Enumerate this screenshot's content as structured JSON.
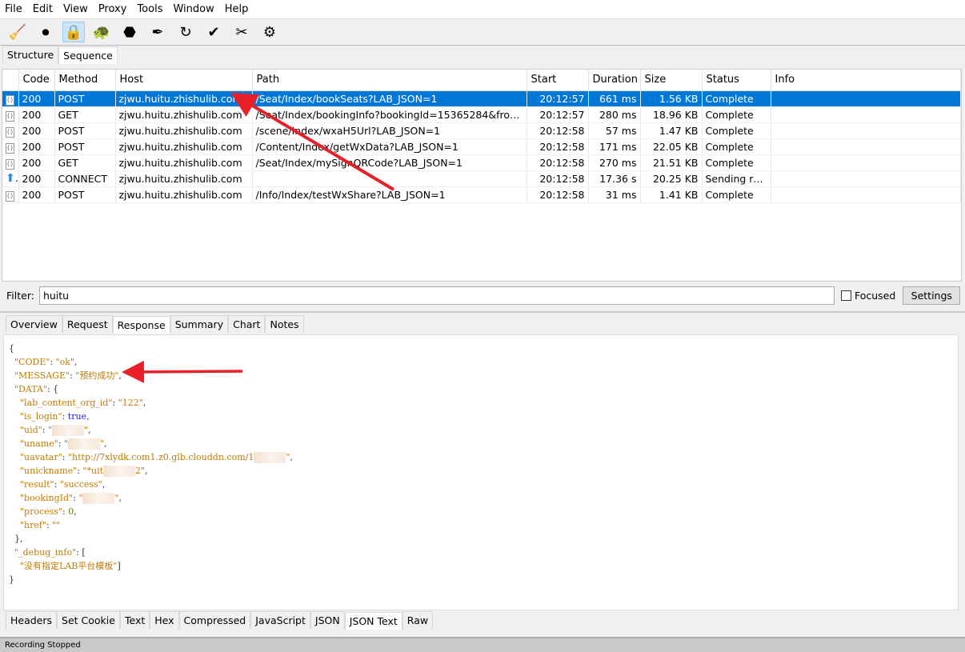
{
  "menu": [
    "File",
    "Edit",
    "View",
    "Proxy",
    "Tools",
    "Window",
    "Help"
  ],
  "toolbar": [
    {
      "icon": "broom-icon",
      "g": "🧹"
    },
    {
      "icon": "record-icon",
      "g": "⏺"
    },
    {
      "icon": "ssl-lock-icon",
      "g": "🔒",
      "active": true
    },
    {
      "icon": "throttle-turtle-icon",
      "g": "🐢"
    },
    {
      "icon": "stop-hexagon-icon",
      "g": "⬣"
    },
    {
      "icon": "compose-pen-icon",
      "g": "✒"
    },
    {
      "icon": "repeat-icon",
      "g": "↻"
    },
    {
      "icon": "validate-check-icon",
      "g": "✔"
    },
    {
      "icon": "tools-icon",
      "g": "✂"
    },
    {
      "icon": "settings-gear-icon",
      "g": "⚙"
    }
  ],
  "view_tabs": [
    "Structure",
    "Sequence"
  ],
  "table": {
    "columns": [
      "",
      "Code",
      "Method",
      "Host",
      "Path",
      "Start",
      "Duration",
      "Size",
      "Status",
      "Info"
    ],
    "rows": [
      [
        "json",
        "200",
        "POST",
        "zjwu.huitu.zhishulib.com",
        "/Seat/Index/bookSeats?LAB_JSON=1",
        "20:12:57",
        "661 ms",
        "1.56 KB",
        "Complete",
        ""
      ],
      [
        "json",
        "200",
        "GET",
        "zjwu.huitu.zhishulib.com",
        "/Seat/Index/bookingInfo?bookingId=15365284&fromTy...",
        "20:12:57",
        "280 ms",
        "18.96 KB",
        "Complete",
        ""
      ],
      [
        "json",
        "200",
        "POST",
        "zjwu.huitu.zhishulib.com",
        "/scene/Index/wxaH5Url?LAB_JSON=1",
        "20:12:58",
        "57 ms",
        "1.47 KB",
        "Complete",
        ""
      ],
      [
        "json",
        "200",
        "POST",
        "zjwu.huitu.zhishulib.com",
        "/Content/Index/getWxData?LAB_JSON=1",
        "20:12:58",
        "171 ms",
        "22.05 KB",
        "Complete",
        ""
      ],
      [
        "json",
        "200",
        "GET",
        "zjwu.huitu.zhishulib.com",
        "/Seat/Index/mySignQRCode?LAB_JSON=1",
        "20:12:58",
        "270 ms",
        "21.51 KB",
        "Complete",
        ""
      ],
      [
        "upload",
        "200",
        "CONNECT",
        "zjwu.huitu.zhishulib.com",
        "",
        "20:12:58",
        "17.36 s",
        "20.25 KB",
        "Sending re...",
        ""
      ],
      [
        "json",
        "200",
        "POST",
        "zjwu.huitu.zhishulib.com",
        "/Info/Index/testWxShare?LAB_JSON=1",
        "20:12:58",
        "31 ms",
        "1.41 KB",
        "Complete",
        ""
      ]
    ]
  },
  "filter": {
    "label": "Filter:",
    "value": "huitu",
    "focused_label": "Focused",
    "settings_label": "Settings"
  },
  "detail_tabs": [
    "Overview",
    "Request",
    "Response",
    "Summary",
    "Chart",
    "Notes"
  ],
  "detail_selected": "Response",
  "body_tabs": [
    "Headers",
    "Set Cookie",
    "Text",
    "Hex",
    "Compressed",
    "JavaScript",
    "JSON",
    "JSON Text",
    "Raw"
  ],
  "body_selected": "JSON Text",
  "json_lines": [
    [
      [
        "p",
        "{"
      ]
    ],
    [
      [
        "p",
        "  "
      ],
      [
        "k",
        "\"CODE\""
      ],
      [
        "p",
        ": "
      ],
      [
        "s",
        "\"ok\""
      ],
      [
        "p",
        ","
      ]
    ],
    [
      [
        "p",
        "  "
      ],
      [
        "k",
        "\"MESSAGE\""
      ],
      [
        "p",
        ": "
      ],
      [
        "s",
        "\"预约成功\""
      ],
      [
        "p",
        ","
      ]
    ],
    [
      [
        "p",
        "  "
      ],
      [
        "k",
        "\"DATA\""
      ],
      [
        "p",
        ": {"
      ]
    ],
    [
      [
        "p",
        "    "
      ],
      [
        "k",
        "\"lab_content_org_id\""
      ],
      [
        "p",
        ": "
      ],
      [
        "s",
        "\"122\""
      ],
      [
        "p",
        ","
      ]
    ],
    [
      [
        "p",
        "    "
      ],
      [
        "k",
        "\"is_login\""
      ],
      [
        "p",
        ": "
      ],
      [
        "b",
        "true"
      ],
      [
        "p",
        ","
      ]
    ],
    [
      [
        "p",
        "    "
      ],
      [
        "k",
        "\"uid\""
      ],
      [
        "p",
        ": "
      ],
      [
        "s",
        "\""
      ],
      [
        "r",
        ""
      ],
      [
        "s",
        "\""
      ],
      [
        "p",
        ","
      ]
    ],
    [
      [
        "p",
        "    "
      ],
      [
        "k",
        "\"uname\""
      ],
      [
        "p",
        ": "
      ],
      [
        "s",
        "\""
      ],
      [
        "r",
        ""
      ],
      [
        "s",
        "\""
      ],
      [
        "p",
        ","
      ]
    ],
    [
      [
        "p",
        "    "
      ],
      [
        "k",
        "\"uavatar\""
      ],
      [
        "p",
        ": "
      ],
      [
        "s",
        "\"http://7xlydk.com1.z0.glb.clouddn.com/1"
      ],
      [
        "r",
        ""
      ],
      [
        "s",
        "\""
      ],
      [
        "p",
        ","
      ]
    ],
    [
      [
        "p",
        "    "
      ],
      [
        "k",
        "\"unickname\""
      ],
      [
        "p",
        ": "
      ],
      [
        "s",
        "\"*uit"
      ],
      [
        "r",
        ""
      ],
      [
        "s",
        "2\""
      ],
      [
        "p",
        ","
      ]
    ],
    [
      [
        "p",
        "    "
      ],
      [
        "k",
        "\"result\""
      ],
      [
        "p",
        ": "
      ],
      [
        "s",
        "\"success\""
      ],
      [
        "p",
        ","
      ]
    ],
    [
      [
        "p",
        "    "
      ],
      [
        "k",
        "\"bookingId\""
      ],
      [
        "p",
        ": "
      ],
      [
        "s",
        "\""
      ],
      [
        "r",
        ""
      ],
      [
        "s",
        "\""
      ],
      [
        "p",
        ","
      ]
    ],
    [
      [
        "p",
        "    "
      ],
      [
        "k",
        "\"process\""
      ],
      [
        "p",
        ": "
      ],
      [
        "n",
        "0"
      ],
      [
        "p",
        ","
      ]
    ],
    [
      [
        "p",
        "    "
      ],
      [
        "k",
        "\"href\""
      ],
      [
        "p",
        ": "
      ],
      [
        "s",
        "\"\""
      ]
    ],
    [
      [
        "p",
        "  },"
      ]
    ],
    [
      [
        "p",
        "  "
      ],
      [
        "k",
        "\"_debug_info\""
      ],
      [
        "p",
        ": ["
      ]
    ],
    [
      [
        "p",
        "    "
      ],
      [
        "s",
        "\"没有指定LAB平台模板\""
      ],
      [
        "p",
        "]"
      ]
    ],
    [
      [
        "p",
        "}"
      ]
    ]
  ],
  "status_text": "Recording Stopped",
  "colors": {
    "selection": "#0078d7",
    "annotation_arrow": "#e8202a",
    "json_key": "#c07a00",
    "json_bool": "#2323d8"
  }
}
